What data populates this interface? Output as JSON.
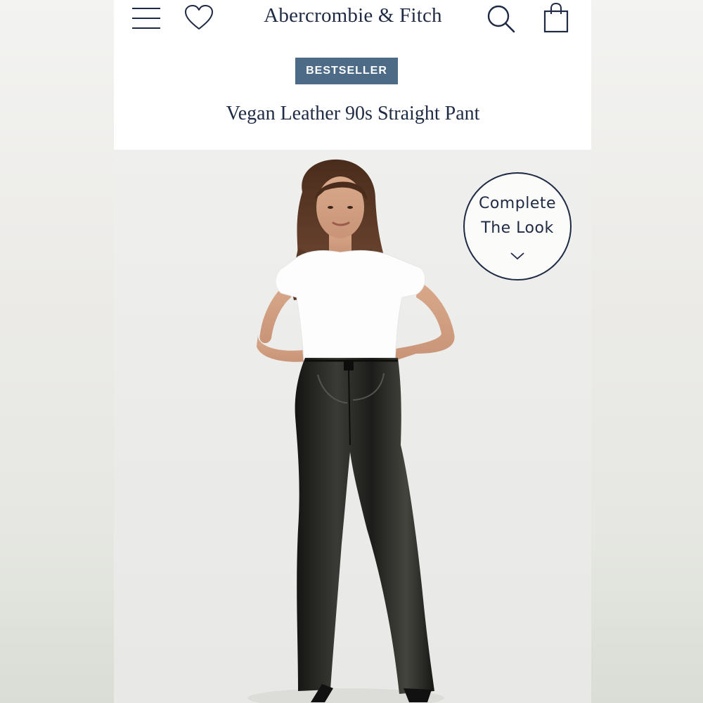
{
  "header": {
    "brand": "Abercrombie & Fitch",
    "menu_icon": "hamburger-menu-icon",
    "wishlist_icon": "heart-icon",
    "search_icon": "search-icon",
    "bag_icon": "shopping-bag-icon"
  },
  "product": {
    "badge": "BESTSELLER",
    "title": "Vegan Leather 90s Straight Pant"
  },
  "complete_look": {
    "line1": "Complete",
    "line2": "The Look",
    "icon": "chevron-down-icon"
  },
  "colors": {
    "navy": "#1f2a44",
    "badge_bg": "#4d6a86",
    "photo_bg": "#ecebe9"
  }
}
